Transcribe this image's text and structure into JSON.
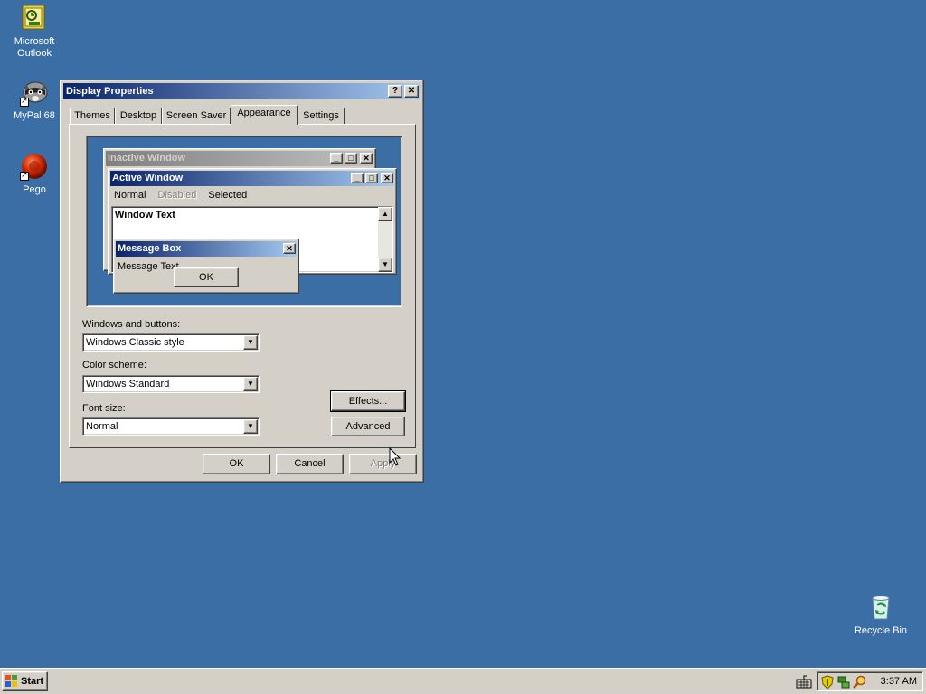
{
  "desktop": {
    "icons": [
      {
        "label_line1": "Microsoft",
        "label_line2": "Outlook",
        "icon": "outlook-icon"
      },
      {
        "label": "MyPal 68",
        "icon": "raccoon-browser-icon"
      },
      {
        "label": "Pego",
        "icon": "red-sphere-icon"
      },
      {
        "label": "Recycle Bin",
        "icon": "recycle-bin-icon"
      }
    ]
  },
  "dialog": {
    "title": "Display Properties",
    "help_button": "?",
    "close_button": "✕",
    "tabs": [
      "Themes",
      "Desktop",
      "Screen Saver",
      "Appearance",
      "Settings"
    ],
    "active_tab": "Appearance",
    "preview": {
      "inactive_title": "Inactive Window",
      "active_title": "Active Window",
      "menu_normal": "Normal",
      "menu_disabled": "Disabled",
      "menu_selected": "Selected",
      "window_text": "Window Text",
      "message_title": "Message Box",
      "message_text": "Message Text",
      "message_ok": "OK"
    },
    "windows_buttons_label": "Windows and buttons:",
    "windows_buttons_value": "Windows Classic style",
    "color_scheme_label": "Color scheme:",
    "color_scheme_value": "Windows Standard",
    "font_size_label": "Font size:",
    "font_size_value": "Normal",
    "effects_button": "Effects...",
    "advanced_button": "Advanced",
    "ok_button": "OK",
    "cancel_button": "Cancel",
    "apply_button": "Apply"
  },
  "taskbar": {
    "start_label": "Start",
    "clock": "3:37 AM"
  },
  "colors": {
    "desktop": "#3b6ea5",
    "face": "#d4d0c8",
    "active_title_start": "#0a246a",
    "active_title_end": "#a6caf0"
  }
}
